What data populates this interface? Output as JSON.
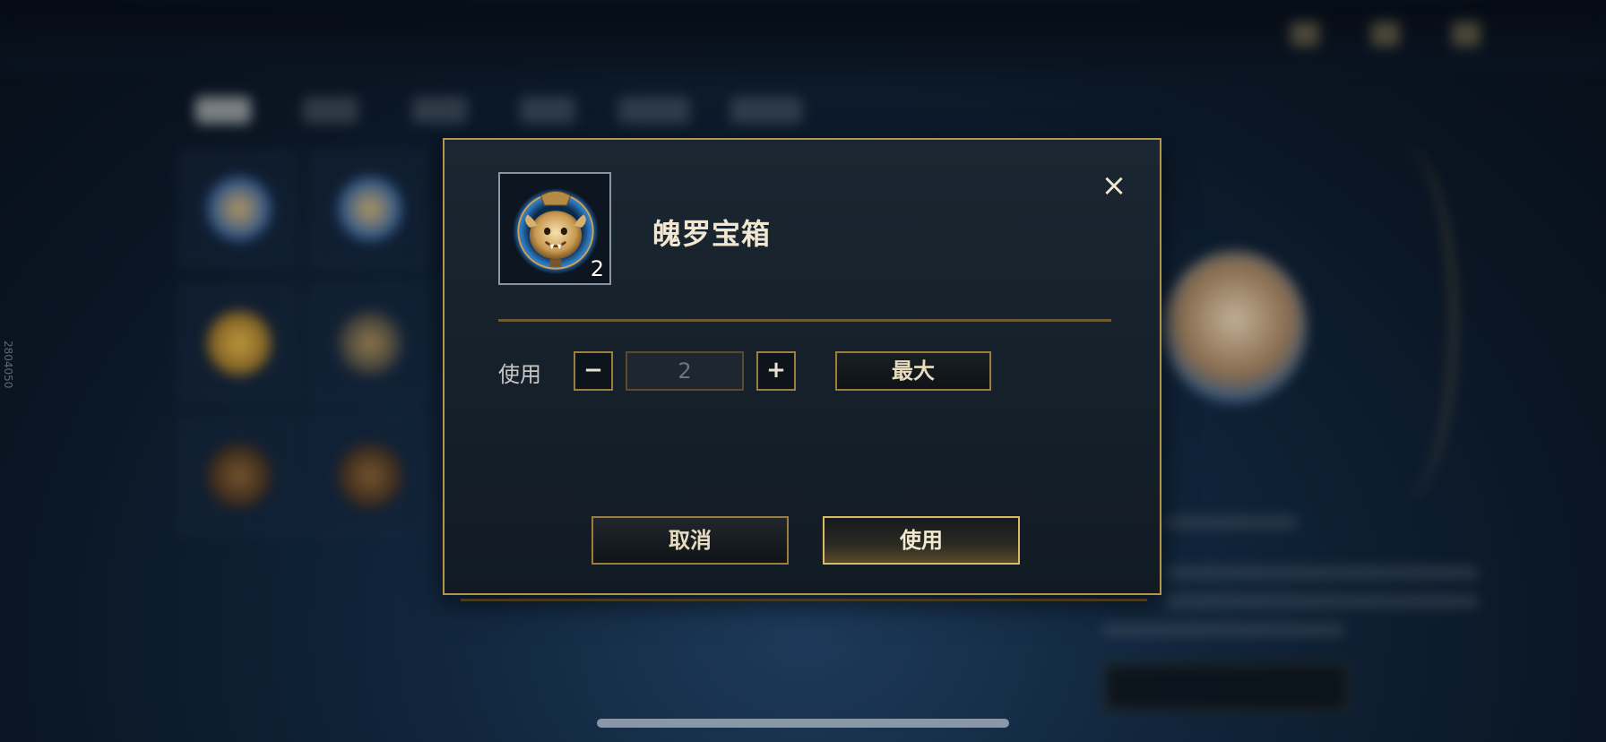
{
  "dialog": {
    "item_name": "魄罗宝箱",
    "item_count": "2",
    "close_label": "×",
    "use_label": "使用",
    "minus_label": "−",
    "plus_label": "+",
    "quantity_value": "2",
    "max_label": "最大",
    "cancel_label": "取消",
    "confirm_label": "使用"
  },
  "side_id": "2804050",
  "icons": {
    "close": "close-icon",
    "item": "poro-chest-icon"
  },
  "colors": {
    "gold_border": "#b5944e",
    "dialog_bg": "#121b24",
    "text_light": "#f0e6d2"
  }
}
